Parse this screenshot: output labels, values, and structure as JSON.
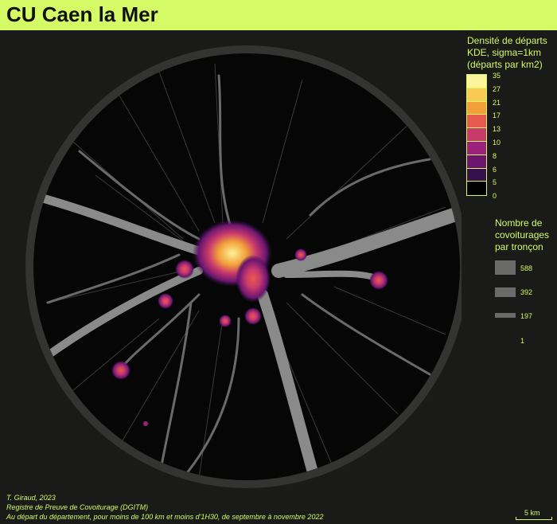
{
  "title": "CU Caen la Mer",
  "density_legend": {
    "title_lines": [
      "Densité de départs",
      "KDE, sigma=1km",
      "(départs par km2)"
    ],
    "breaks": [
      "35",
      "27",
      "21",
      "17",
      "13",
      "10",
      "8",
      "6",
      "5",
      "0"
    ],
    "colors": [
      "#fcf39a",
      "#f9cb56",
      "#f3a03a",
      "#e85a4f",
      "#c93a6c",
      "#9c217a",
      "#6b1570",
      "#36124d",
      "#000000"
    ]
  },
  "flow_legend": {
    "title_lines": [
      "Nombre de",
      "covoiturages",
      "par tronçon"
    ],
    "values": [
      "588",
      "392",
      "197",
      "1"
    ]
  },
  "credits": [
    "T. Giraud, 2023",
    "Registre de Preuve de Covoiturage (DGITM)",
    "Au départ du département, pour moins de 100 km et moins d'1H30, de septembre à novembre 2022"
  ],
  "scale": {
    "label": "5 km"
  }
}
